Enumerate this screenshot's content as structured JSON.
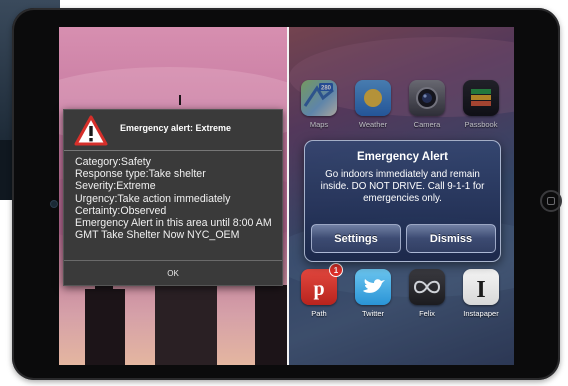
{
  "android_alert": {
    "title": "Emergency alert: Extreme",
    "icon": "warning-triangle-icon",
    "lines": [
      "Category:Safety",
      "Response type:Take shelter",
      "Severity:Extreme",
      "Urgency:Take action immediately",
      "Certainty:Observed"
    ],
    "message": "Emergency Alert in this area until 8:00 AM GMT Take Shelter Now NYC_OEM",
    "ok_label": "OK"
  },
  "ios_alert": {
    "title": "Emergency Alert",
    "message": "Go indoors immediately and remain inside. DO NOT DRIVE. Call 9-1-1 for emergencies only.",
    "settings_label": "Settings",
    "dismiss_label": "Dismiss"
  },
  "ios_home": {
    "top_row": [
      {
        "label": "Maps",
        "icon": "maps-icon",
        "badge": "280"
      },
      {
        "label": "Weather",
        "icon": "weather-icon"
      },
      {
        "label": "Camera",
        "icon": "camera-icon"
      },
      {
        "label": "Passbook",
        "icon": "passbook-icon"
      }
    ],
    "bottom_row": [
      {
        "label": "Path",
        "icon": "path-icon",
        "badge": "1"
      },
      {
        "label": "Twitter",
        "icon": "twitter-icon"
      },
      {
        "label": "Felix",
        "icon": "felix-icon"
      },
      {
        "label": "Instapaper",
        "icon": "instapaper-icon"
      }
    ]
  },
  "colors": {
    "android_dialog_bg": "#3a3a3a",
    "ios_alert_bg": "#2a3a64",
    "warning_red": "#d62f2a"
  }
}
